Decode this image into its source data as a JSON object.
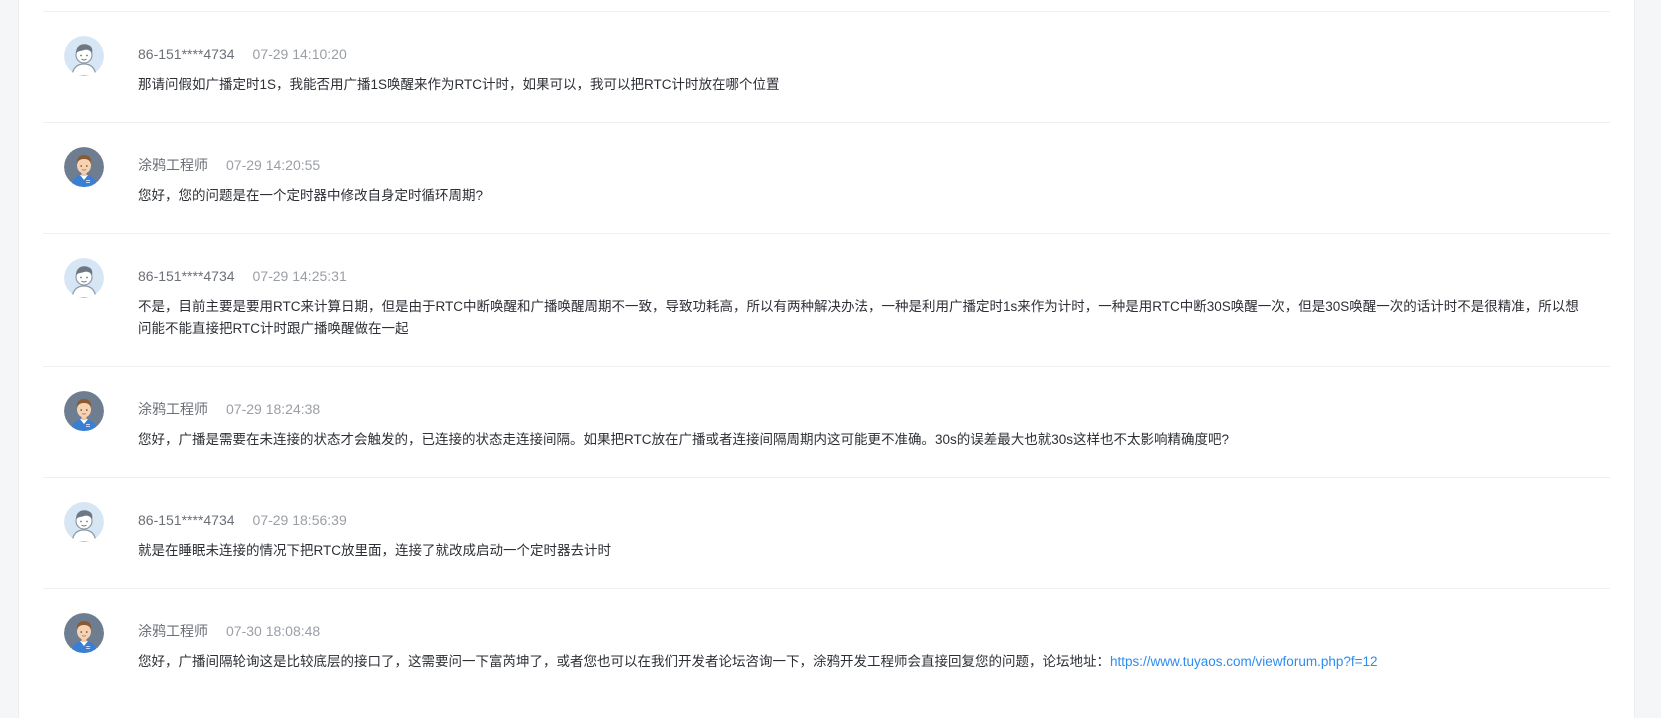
{
  "comments": [
    {
      "author": "86-151****4734",
      "role": "user",
      "time": "07-29 14:10:20",
      "text": "那请问假如广播定时1S，我能否用广播1S唤醒来作为RTC计时，如果可以，我可以把RTC计时放在哪个位置"
    },
    {
      "author": "涂鸦工程师",
      "role": "engineer",
      "time": "07-29 14:20:55",
      "text": "您好，您的问题是在一个定时器中修改自身定时循环周期?"
    },
    {
      "author": "86-151****4734",
      "role": "user",
      "time": "07-29 14:25:31",
      "text": "不是，目前主要是要用RTC来计算日期，但是由于RTC中断唤醒和广播唤醒周期不一致，导致功耗高，所以有两种解决办法，一种是利用广播定时1s来作为计时，一种是用RTC中断30S唤醒一次，但是30S唤醒一次的话计时不是很精准，所以想问能不能直接把RTC计时跟广播唤醒做在一起"
    },
    {
      "author": "涂鸦工程师",
      "role": "engineer",
      "time": "07-29 18:24:38",
      "text": "您好，广播是需要在未连接的状态才会触发的，已连接的状态走连接间隔。如果把RTC放在广播或者连接间隔周期内这可能更不准确。30s的误差最大也就30s这样也不太影响精确度吧?"
    },
    {
      "author": "86-151****4734",
      "role": "user",
      "time": "07-29 18:56:39",
      "text": "就是在睡眠未连接的情况下把RTC放里面，连接了就改成启动一个定时器去计时"
    },
    {
      "author": "涂鸦工程师",
      "role": "engineer",
      "time": "07-30 18:08:48",
      "text": "您好，广播间隔轮询这是比较底层的接口了，这需要问一下富芮坤了，或者您也可以在我们开发者论坛咨询一下，涂鸦开发工程师会直接回复您的问题，论坛地址：",
      "link": "https://www.tuyaos.com/viewforum.php?f=12"
    }
  ],
  "colors": {
    "link": "#2d8cf0",
    "author": "#6b6f77",
    "time": "#9a9ea6",
    "text": "#2c2f35"
  },
  "icons": {
    "user": "user-avatar-icon",
    "engineer": "engineer-avatar-icon"
  }
}
